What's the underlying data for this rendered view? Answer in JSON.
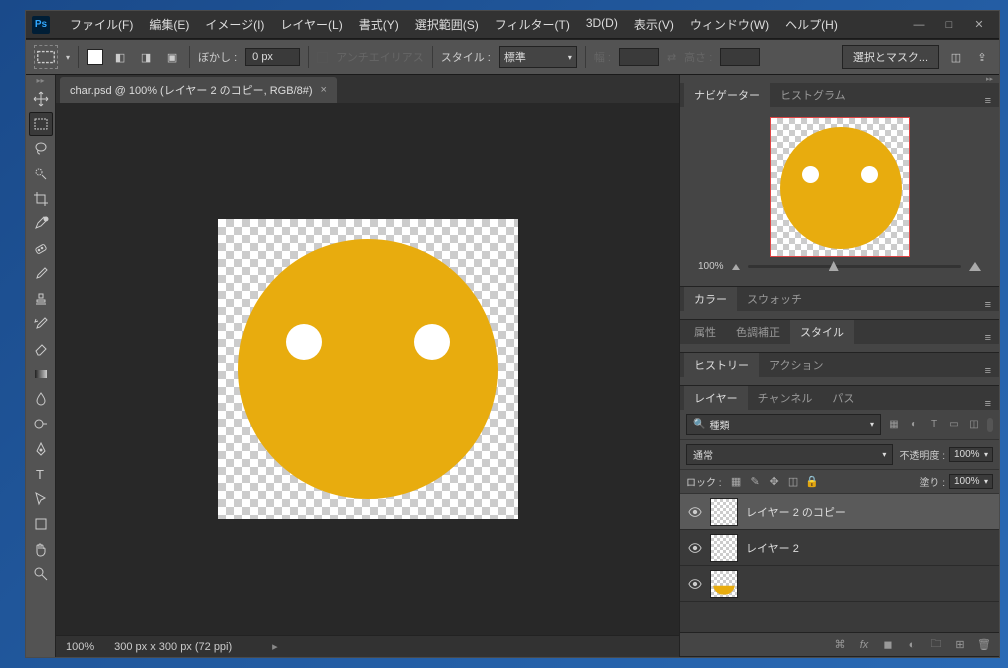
{
  "menubar": [
    "ファイル(F)",
    "編集(E)",
    "イメージ(I)",
    "レイヤー(L)",
    "書式(Y)",
    "選択範囲(S)",
    "フィルター(T)",
    "3D(D)",
    "表示(V)",
    "ウィンドウ(W)",
    "ヘルプ(H)"
  ],
  "options": {
    "feather_label": "ぼかし :",
    "feather_value": "0 px",
    "antialias": "アンチエイリアス",
    "style_label": "スタイル :",
    "style_value": "標準",
    "width_label": "幅 :",
    "height_label": "高さ :",
    "mask_button": "選択とマスク..."
  },
  "document": {
    "tab_title": "char.psd @ 100% (レイヤー 2 のコピー, RGB/8#)",
    "status_zoom": "100%",
    "status_dims": "300 px x 300 px (72 ppi)"
  },
  "panels": {
    "navigator": {
      "tabs": [
        "ナビゲーター",
        "ヒストグラム"
      ],
      "zoom": "100%"
    },
    "color": {
      "tabs": [
        "カラー",
        "スウォッチ"
      ]
    },
    "properties": {
      "tabs": [
        "属性",
        "色調補正",
        "スタイル"
      ],
      "active_index": 2
    },
    "history": {
      "tabs": [
        "ヒストリー",
        "アクション"
      ]
    },
    "layers": {
      "tabs": [
        "レイヤー",
        "チャンネル",
        "パス"
      ],
      "filter_kind": "種類",
      "blend_mode": "通常",
      "opacity_label": "不透明度 :",
      "opacity_value": "100%",
      "lock_label": "ロック :",
      "fill_label": "塗り :",
      "fill_value": "100%",
      "items": [
        {
          "name": "レイヤー 2 のコピー",
          "selected": true,
          "visible": true,
          "thumb": "blank"
        },
        {
          "name": "レイヤー 2",
          "selected": false,
          "visible": true,
          "thumb": "blank"
        },
        {
          "name": "",
          "selected": false,
          "visible": true,
          "thumb": "face"
        }
      ]
    }
  },
  "colors": {
    "face": "#e8ac0e",
    "eye": "#ffffff"
  }
}
